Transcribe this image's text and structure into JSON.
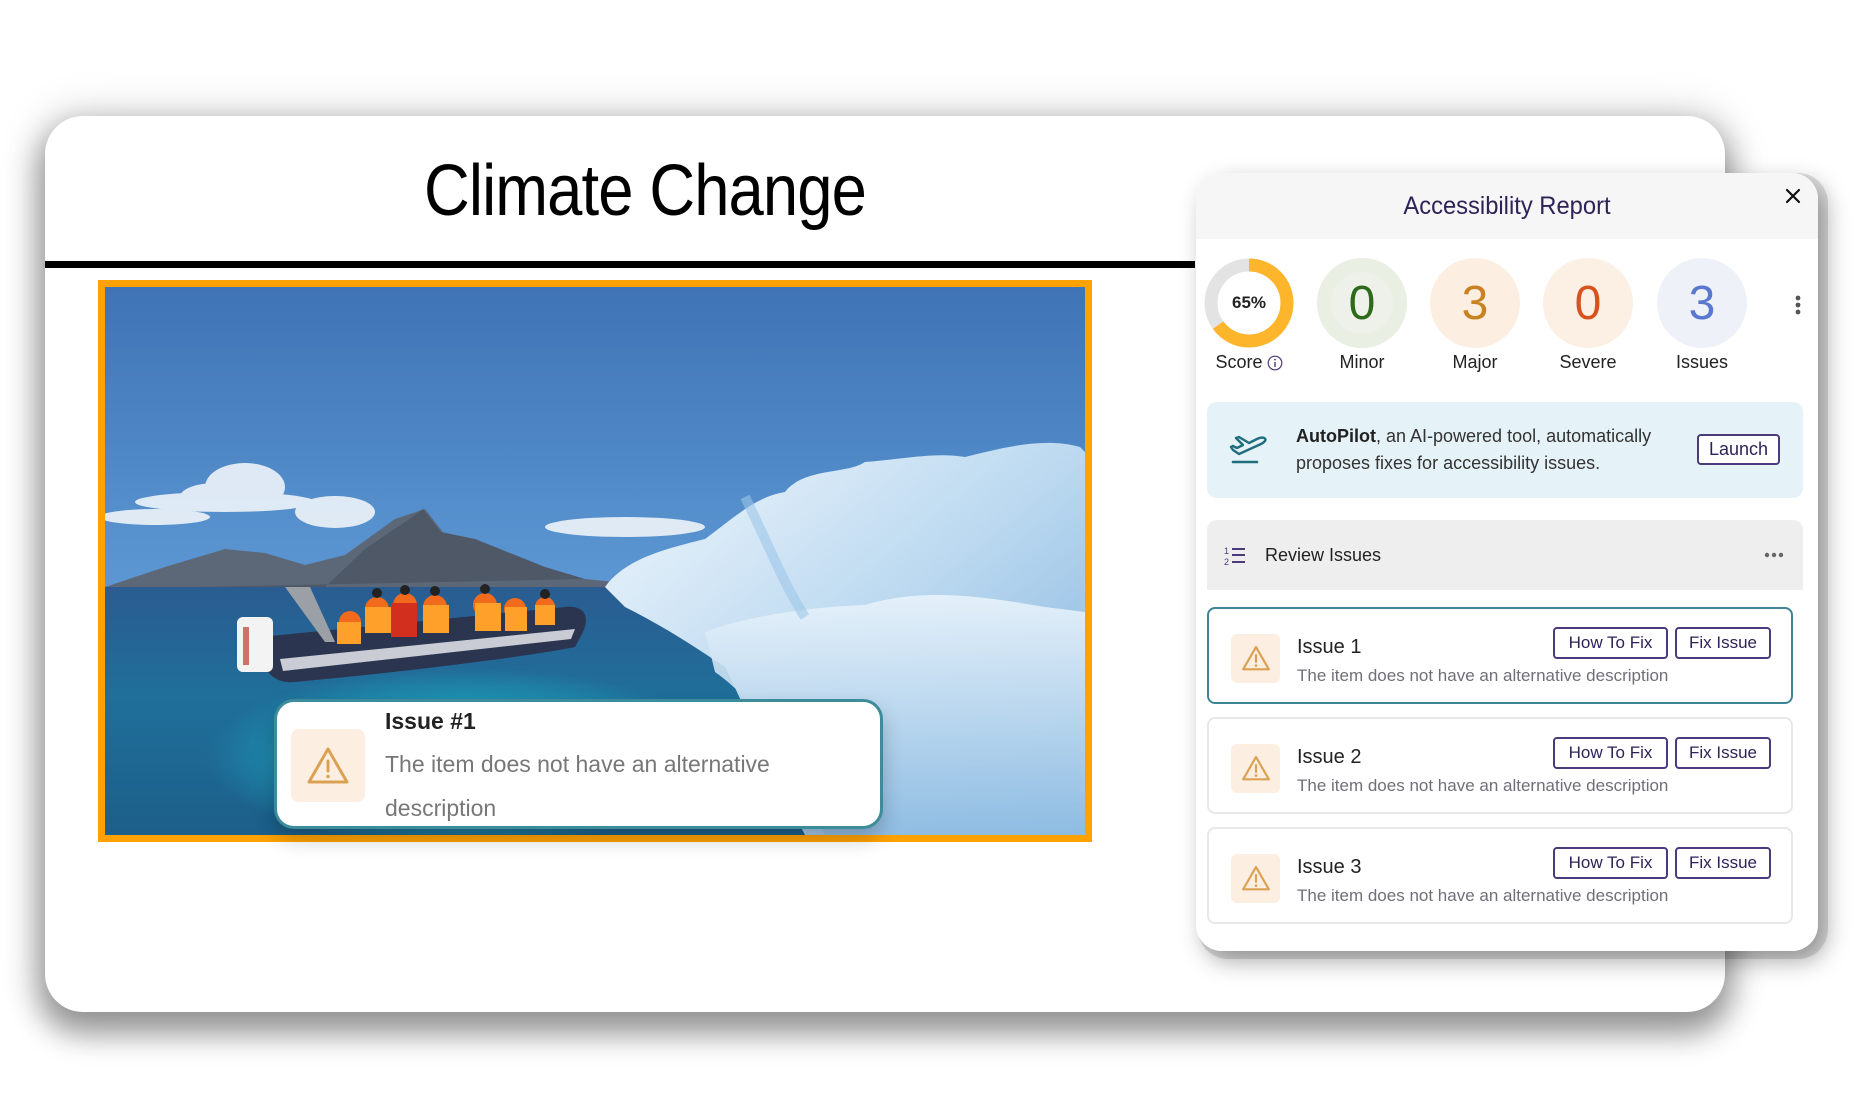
{
  "slide": {
    "title": "Climate Change",
    "image": {
      "subject": "people in orange survival suits on an inflatable boat beside an iceberg, mountains in background",
      "highlight_color": "#FFA200"
    }
  },
  "tooltip": {
    "title": "Issue #1",
    "description": "The item does not have an alternative description",
    "icon": "warning-triangle-icon"
  },
  "panel": {
    "title": "Accessibility Report",
    "close_icon": "close-icon",
    "score": {
      "value": 0.65,
      "label_text": "65%",
      "label": "Score",
      "info_icon": "info-icon",
      "color": "#FDB52B",
      "track_color": "#E3E3E3"
    },
    "stats": [
      {
        "key": "minor",
        "value": "0",
        "label": "Minor",
        "color": "#2F6A1A",
        "bg": "#EAEFE3"
      },
      {
        "key": "major",
        "value": "3",
        "label": "Major",
        "color": "#C98222",
        "bg": "#FCEFE1"
      },
      {
        "key": "severe",
        "value": "0",
        "label": "Severe",
        "color": "#D7521D",
        "bg": "#FCEFE3"
      },
      {
        "key": "issues",
        "value": "3",
        "label": "Issues",
        "color": "#5A78D0",
        "bg": "#EEF2F8"
      }
    ],
    "more_icon": "kebab-menu-icon",
    "autopilot": {
      "icon": "airplane-takeoff-icon",
      "name": "AutoPilot",
      "text_line1": ", an AI-powered tool, automatically",
      "text_line2": "proposes fixes for accessibility issues.",
      "button": "Launch"
    },
    "review": {
      "title": "Review Issues",
      "icon": "numbered-list-icon",
      "more_icon": "ellipsis-icon",
      "issues": [
        {
          "title": "Issue 1",
          "description": "The item does not have an alternative description",
          "how_to_fix": "How To Fix",
          "fix_issue": "Fix Issue",
          "selected": true
        },
        {
          "title": "Issue 2",
          "description": "The item does not have an alternative description",
          "how_to_fix": "How To Fix",
          "fix_issue": "Fix Issue",
          "selected": false
        },
        {
          "title": "Issue 3",
          "description": "The item does not have an alternative description",
          "how_to_fix": "How To Fix",
          "fix_issue": "Fix Issue",
          "selected": false
        }
      ]
    }
  }
}
